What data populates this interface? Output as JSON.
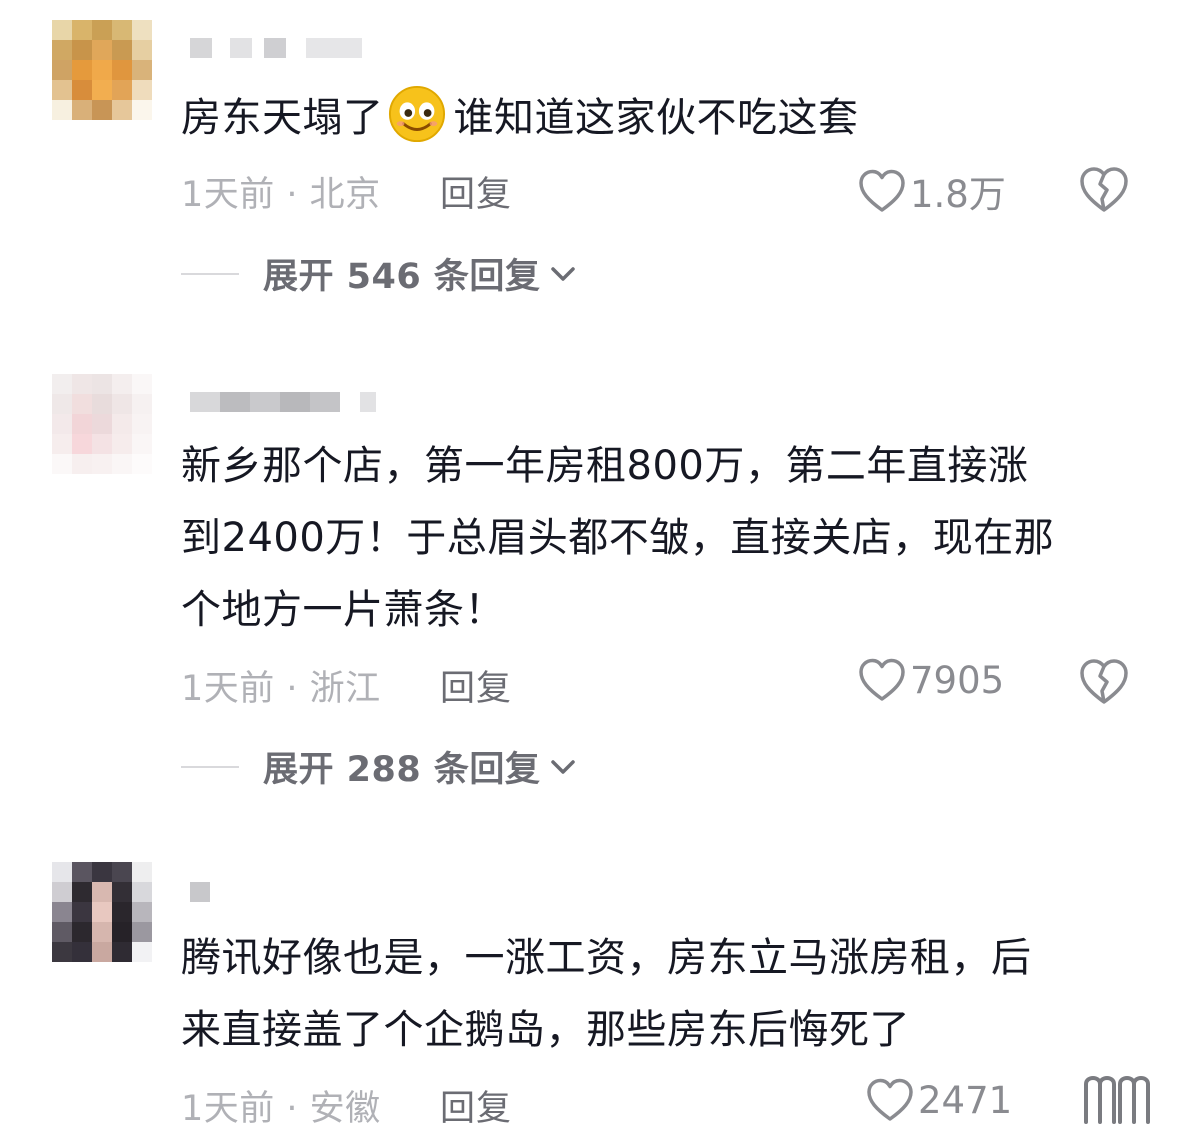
{
  "comments": [
    {
      "text_before_emoji": "房东天塌了",
      "emoji": "smiling-face-emoji",
      "text_after_emoji": "谁知道这家伙不吃这套",
      "time_location": "1天前 · 北京",
      "reply_label": "回复",
      "likes": "1.8万",
      "expand_label": "展开 546 条回复"
    },
    {
      "text": "新乡那个店，第一年房租800万，第二年直接涨\n到2400万！于总眉头都不皱，直接关店，现在那\n个地方一片萧条！",
      "time_location": "1天前 · 浙江",
      "reply_label": "回复",
      "likes": "7905",
      "expand_label": "展开 288 条回复"
    },
    {
      "text": "腾讯好像也是，一涨工资，房东立马涨房租，后\n来直接盖了个企鹅岛，那些房东后悔死了",
      "time_location": "1天前 · 安徽",
      "reply_label": "回复",
      "likes": "2471"
    }
  ],
  "colors": {
    "text": "#161823",
    "meta": "#b0b1b6",
    "secondary": "#6b6c73",
    "icon": "#8a8b90"
  }
}
